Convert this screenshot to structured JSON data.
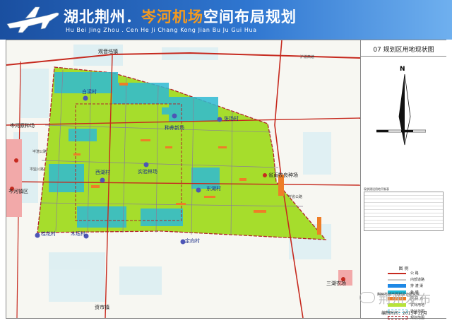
{
  "header": {
    "title_part1": "湖北荆州．",
    "title_part2": "岑河机场",
    "title_part3": "空间布局规划",
    "pinyin": "Hu Bei Jing Zhou . Cen He Ji Chang Kong Jian Bu Ju Gui Hua"
  },
  "sidebar": {
    "sheet_title": "07  规划区用地现状图",
    "north_label": "N",
    "table_title": "现状建设用地平衡表",
    "legend_title": "图    例",
    "legend": [
      {
        "label": "公    路",
        "color": "#c62a1f"
      },
      {
        "label": "内部道路",
        "color": "#c8c8c8"
      },
      {
        "label": "排 灌 渠",
        "color": "#1e88e5"
      },
      {
        "label": "鱼    塘",
        "color": "#1fb8d6"
      },
      {
        "label": "居 民 点",
        "color": "#ee7d27"
      },
      {
        "label": "农林用地",
        "color": "#b7e33a"
      },
      {
        "label": "场址范围",
        "color": "#4bbfd6"
      },
      {
        "label": "规划范围",
        "color": "#b3232a"
      }
    ],
    "org": "荆州市城市规划设计研究院",
    "date": "编制时间：2015年12月"
  },
  "map": {
    "places": [
      {
        "name": "观音垱镇",
        "color": "dark"
      },
      {
        "name": "白渎村",
        "color": "blue"
      },
      {
        "name": "种养新场",
        "color": "blue"
      },
      {
        "name": "张场村",
        "color": "blue"
      },
      {
        "name": "西湖村",
        "color": "blue"
      },
      {
        "name": "实验林场",
        "color": "blue"
      },
      {
        "name": "省直牧良种场",
        "color": "dark"
      },
      {
        "name": "东湖村",
        "color": "blue"
      },
      {
        "name": "岑河原种场",
        "color": "dark"
      },
      {
        "name": "岑河镇区",
        "color": "dark"
      },
      {
        "name": "桂花村",
        "color": "blue"
      },
      {
        "name": "木坛村",
        "color": "blue"
      },
      {
        "name": "定向村",
        "color": "blue"
      },
      {
        "name": "三湖农场",
        "color": "dark"
      },
      {
        "name": "资市镇",
        "color": "dark"
      }
    ],
    "roads": [
      "沪渝高速",
      "岑监公路",
      "岑省公路",
      "岑潜公路"
    ]
  },
  "watermark": "荆州发布"
}
